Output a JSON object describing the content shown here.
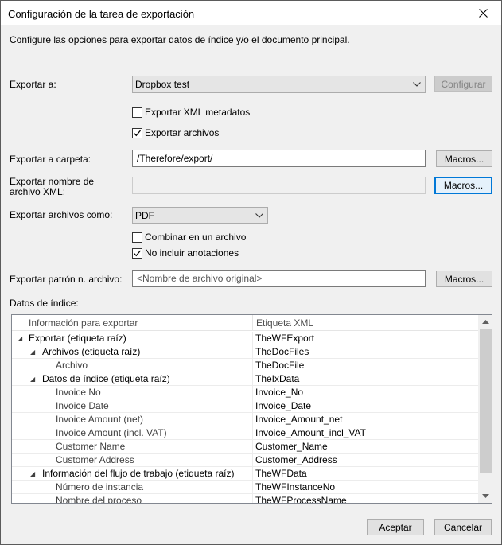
{
  "window": {
    "title": "Configuración de la tarea de exportación"
  },
  "description": "Configure las opciones para exportar datos de índice y/o el documento principal.",
  "export_to": {
    "label": "Exportar a:",
    "value": "Dropbox test",
    "configure_label": "Configurar"
  },
  "options": {
    "export_xml_metadata": {
      "label": "Exportar XML metadatos",
      "checked": false
    },
    "export_files": {
      "label": "Exportar archivos",
      "checked": true
    }
  },
  "export_folder": {
    "label": "Exportar a carpeta:",
    "value": "/Therefore/export/",
    "macros_label": "Macros..."
  },
  "xml_filename": {
    "label_line1": "Exportar nombre de",
    "label_line2": "archivo XML:",
    "value": "",
    "macros_label": "Macros..."
  },
  "export_as": {
    "label": "Exportar archivos como:",
    "value": "PDF"
  },
  "file_options": {
    "combine": {
      "label": "Combinar en un archivo",
      "checked": false
    },
    "no_annotations": {
      "label": "No incluir anotaciones",
      "checked": true
    }
  },
  "filename_pattern": {
    "label": "Exportar patrón n. archivo:",
    "value": "<Nombre de archivo original>",
    "macros_label": "Macros..."
  },
  "index_data": {
    "label": "Datos de índice:",
    "columns": [
      "Información para exportar",
      "Etiqueta XML"
    ],
    "rows": [
      {
        "name": "Exportar (etiqueta raíz)",
        "tag": "TheWFExport",
        "level": 0,
        "expander": true
      },
      {
        "name": "Archivos (etiqueta raíz)",
        "tag": "TheDocFiles",
        "level": 1,
        "expander": true
      },
      {
        "name": "Archivo",
        "tag": "TheDocFile",
        "level": 2,
        "expander": false
      },
      {
        "name": "Datos de índice (etiqueta raíz)",
        "tag": "TheIxData",
        "level": 1,
        "expander": true
      },
      {
        "name": "Invoice No",
        "tag": "Invoice_No",
        "level": 2,
        "expander": false
      },
      {
        "name": "Invoice Date",
        "tag": "Invoice_Date",
        "level": 2,
        "expander": false
      },
      {
        "name": "Invoice Amount (net)",
        "tag": "Invoice_Amount_net",
        "level": 2,
        "expander": false
      },
      {
        "name": "Invoice Amount (incl. VAT)",
        "tag": "Invoice_Amount_incl_VAT",
        "level": 2,
        "expander": false
      },
      {
        "name": "Customer Name",
        "tag": "Customer_Name",
        "level": 2,
        "expander": false
      },
      {
        "name": "Customer Address",
        "tag": "Customer_Address",
        "level": 2,
        "expander": false
      },
      {
        "name": "Información del flujo de trabajo (etiqueta raíz)",
        "tag": "TheWFData",
        "level": 1,
        "expander": true
      },
      {
        "name": "Número de instancia",
        "tag": "TheWFInstanceNo",
        "level": 2,
        "expander": false
      },
      {
        "name": "Nombre del proceso",
        "tag": "TheWFProcessName",
        "level": 2,
        "expander": false
      }
    ]
  },
  "footer": {
    "accept_label": "Aceptar",
    "cancel_label": "Cancelar"
  },
  "icons": {
    "close": "close-icon",
    "combo_arrow": "chevron-down-icon",
    "checkmark": "checkmark-icon",
    "tree_expander": "triangle-expanded-icon"
  },
  "colors": {
    "focus_border": "#0078d7",
    "window_bg": "#f0f0f0"
  }
}
